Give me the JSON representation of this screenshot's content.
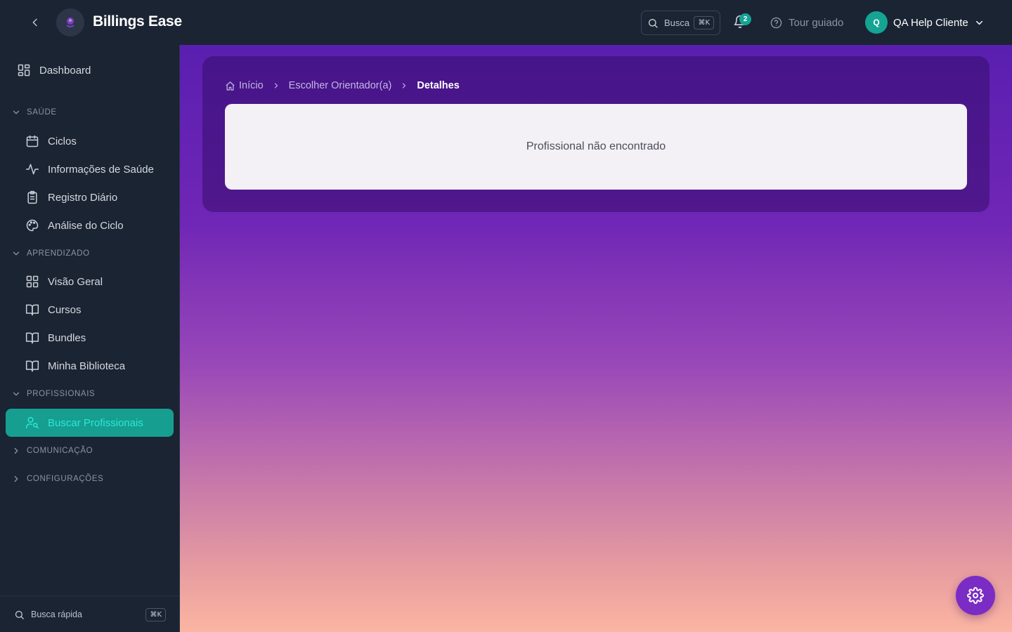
{
  "app": {
    "brand_name": "Billings Ease"
  },
  "header": {
    "search_label": "Busca",
    "search_shortcut": "⌘K",
    "notifications_count": "2",
    "tour_label": "Tour guiado",
    "user_initial": "Q",
    "user_name": "QA Help Cliente"
  },
  "sidebar": {
    "dashboard_label": "Dashboard",
    "sections": {
      "saude": "SAÚDE",
      "aprendizado": "APRENDIZADO",
      "profissionais": "PROFISSIONAIS",
      "comunicacao": "COMUNICAÇÃO",
      "configuracoes": "CONFIGURAÇÕES"
    },
    "items": {
      "ciclos": "Ciclos",
      "informacoes_saude": "Informações de Saúde",
      "registro_diario": "Registro Diário",
      "analise_ciclo": "Análise do Ciclo",
      "visao_geral": "Visão Geral",
      "cursos": "Cursos",
      "bundles": "Bundles",
      "minha_biblioteca": "Minha Biblioteca",
      "buscar_profissionais": "Buscar Profissionais"
    },
    "active_item": "Buscar Profissionais",
    "quick_search_label": "Busca rápida",
    "quick_search_shortcut": "⌘K"
  },
  "main": {
    "breadcrumb": {
      "home": "Início",
      "parent": "Escolher Orientador(a)",
      "current": "Detalhes"
    },
    "message": "Profissional não encontrado"
  },
  "colors": {
    "sidebar_bg": "#1b2433",
    "accent_teal": "#169e91",
    "fab_purple": "#7a2cc4",
    "gradient_top": "#5a1fb0",
    "gradient_bottom": "#fbb5a2"
  },
  "icons": {
    "back": "chevron-left-icon",
    "search": "search-icon",
    "bell": "bell-icon",
    "help": "help-circle-icon",
    "user_menu": "chevron-down-icon",
    "fab": "gear-icon"
  }
}
